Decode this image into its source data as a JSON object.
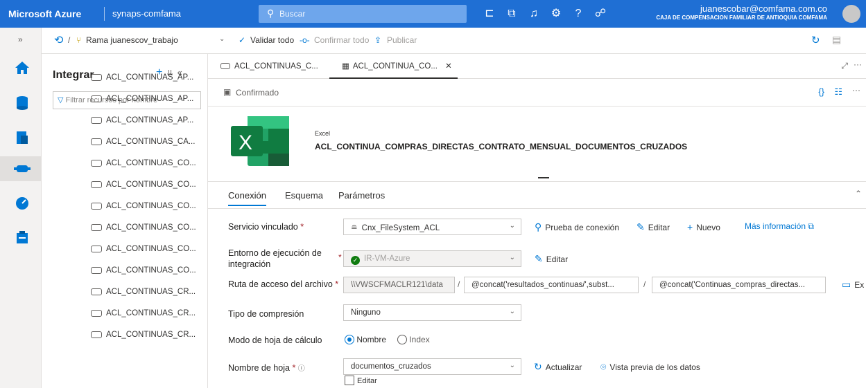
{
  "topbar": {
    "brand": "Microsoft Azure",
    "workspace": "synaps-comfama",
    "search_placeholder": "Buscar",
    "user_email": "juanescobar@comfama.com.co",
    "user_org": "CAJA DE COMPENSACION FAMILIAR DE ANTIOQUIA COMFAMA",
    "icons": [
      "feedback-icon",
      "directory-icon",
      "notifications-icon",
      "settings-icon",
      "help-icon",
      "cloud-shell-icon"
    ]
  },
  "toolbar": {
    "branch": "Rama juanescov_trabajo",
    "validate_all": "Validar todo",
    "confirm_all": "Confirmar todo",
    "publish": "Publicar"
  },
  "panel": {
    "title": "Integrar",
    "filter_placeholder": "Filtrar recursos por nombre",
    "items": [
      "ACL_CONTINUAS_AP...",
      "ACL_CONTINUAS_AP...",
      "ACL_CONTINUAS_AP...",
      "ACL_CONTINUAS_CA...",
      "ACL_CONTINUAS_CO...",
      "ACL_CONTINUAS_CO...",
      "ACL_CONTINUAS_CO...",
      "ACL_CONTINUAS_CO...",
      "ACL_CONTINUAS_CO...",
      "ACL_CONTINUAS_CO...",
      "ACL_CONTINUAS_CR...",
      "ACL_CONTINUAS_CR...",
      "ACL_CONTINUAS_CR..."
    ]
  },
  "tabs": [
    {
      "label": "ACL_CONTINUAS_C..."
    },
    {
      "label": "ACL_CONTINUA_CO..."
    }
  ],
  "status": {
    "label": "Confirmado"
  },
  "dataset": {
    "type": "Excel",
    "name": "ACL_CONTINUA_COMPRAS_DIRECTAS_CONTRATO_MENSUAL_DOCUMENTOS_CRUZADOS"
  },
  "detail_tabs": [
    "Conexión",
    "Esquema",
    "Parámetros"
  ],
  "form": {
    "linked_service": {
      "label": "Servicio vinculado",
      "value": "Cnx_FileSystem_ACL",
      "test": "Prueba de conexión",
      "edit": "Editar",
      "new": "Nuevo",
      "more": "Más información"
    },
    "runtime": {
      "label": "Entorno de ejecución de integración",
      "value": "IR-VM-Azure",
      "edit": "Editar"
    },
    "path": {
      "label": "Ruta de acceso del archivo",
      "part1": "\\\\VWSCFMACLR121\\data",
      "part2": "@concat('resultados_continuas/',subst...",
      "part3": "@concat('Continuas_compras_directas...",
      "browse": "Ex"
    },
    "compression": {
      "label": "Tipo de compresión",
      "value": "Ninguno"
    },
    "sheet_mode": {
      "label": "Modo de hoja de cálculo",
      "opt1": "Nombre",
      "opt2": "Index",
      "selected": "Nombre"
    },
    "sheet_name": {
      "label": "Nombre de hoja",
      "value": "documentos_cruzados",
      "refresh": "Actualizar",
      "preview": "Vista previa de los datos",
      "edit_checkbox": "Editar"
    }
  }
}
